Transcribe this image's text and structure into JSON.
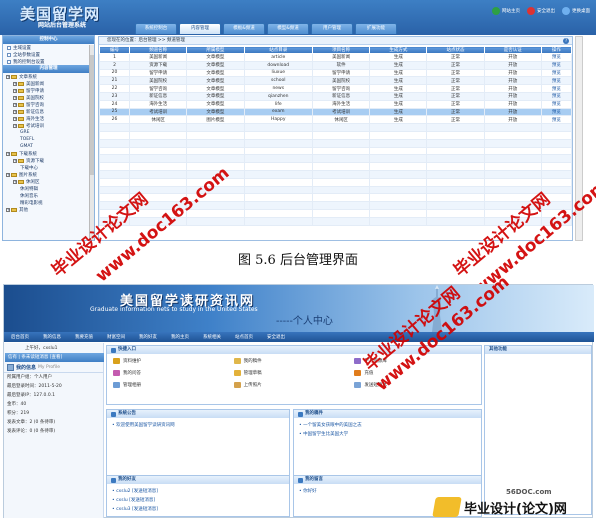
{
  "admin": {
    "logo_big": "美国留学网",
    "logo_small": "网站后台管理系统",
    "tabs": [
      "系统控制台",
      "内容管理",
      "模板&频道",
      "模型&频道",
      "用户管理",
      "扩展功能"
    ],
    "active_tab": 1,
    "actions": [
      "网站主页",
      "安全退出",
      "更换桌面"
    ],
    "sidebar": {
      "header": "控制中心",
      "top_items": [
        "主域设置",
        "全站参数设置",
        "我的控制台设置"
      ],
      "content_header": "内容管理",
      "tree": [
        {
          "label": "文章系统",
          "level": 0,
          "folder": true
        },
        {
          "label": "美国新闻",
          "level": 1,
          "folder": true
        },
        {
          "label": "留学申请",
          "level": 1,
          "folder": true
        },
        {
          "label": "美国院校",
          "level": 1,
          "folder": true
        },
        {
          "label": "留学咨询",
          "level": 1,
          "folder": true
        },
        {
          "label": "新证信息",
          "level": 1,
          "folder": true
        },
        {
          "label": "海外生活",
          "level": 1,
          "folder": true
        },
        {
          "label": "考试培训",
          "level": 1,
          "folder": true
        },
        {
          "label": "GRE",
          "level": 2,
          "folder": false
        },
        {
          "label": "TOEFL",
          "level": 2,
          "folder": false
        },
        {
          "label": "GMAT",
          "level": 2,
          "folder": false
        },
        {
          "label": "下载系统",
          "level": 0,
          "folder": true
        },
        {
          "label": "资源下载",
          "level": 1,
          "folder": true
        },
        {
          "label": "下载中心",
          "level": 2,
          "folder": false
        },
        {
          "label": "图片系统",
          "level": 0,
          "folder": true
        },
        {
          "label": "休闲区",
          "level": 1,
          "folder": true
        },
        {
          "label": "休闲特辑",
          "level": 2,
          "folder": false
        },
        {
          "label": "休闲音乐",
          "level": 2,
          "folder": false
        },
        {
          "label": "精彩电影视",
          "level": 2,
          "folder": false
        },
        {
          "label": "其他",
          "level": 0,
          "folder": true
        }
      ]
    },
    "crumb": "您现在的位置：后台管理 >> 频道管理",
    "table": {
      "headers": [
        "编号",
        "频道名称",
        "所属模型",
        "站点目录",
        "项目名称",
        "生成方式",
        "站点状态",
        "是否认证",
        "操作"
      ],
      "rows": [
        [
          "1",
          "美国新闻",
          "文章模型",
          "article",
          "美国新闻",
          "生成",
          "正常",
          "开放",
          "预览"
        ],
        [
          "2",
          "资源下载",
          "文章模型",
          "download",
          "软件",
          "生成",
          "正常",
          "开放",
          "预览"
        ],
        [
          "20",
          "留学申请",
          "文章模型",
          "liuxue",
          "留学申请",
          "生成",
          "正常",
          "开放",
          "预览"
        ],
        [
          "21",
          "美国院校",
          "文章模型",
          "school",
          "美国院校",
          "生成",
          "正常",
          "开放",
          "预览"
        ],
        [
          "22",
          "留学咨询",
          "文章模型",
          "news",
          "留学咨询",
          "生成",
          "正常",
          "开放",
          "预览"
        ],
        [
          "23",
          "新证信息",
          "文章模型",
          "qianzhen",
          "新证信息",
          "生成",
          "正常",
          "开放",
          "预览"
        ],
        [
          "24",
          "海外生活",
          "文章模型",
          "life",
          "海外生活",
          "生成",
          "正常",
          "开放",
          "预览"
        ],
        [
          "25",
          "考试培训",
          "文章模型",
          "exam",
          "考试培训",
          "生成",
          "正常",
          "开放",
          "预览"
        ],
        [
          "26",
          "休闲区",
          "图片模型",
          "Happy",
          "休闲区",
          "生成",
          "正常",
          "开放",
          "预览"
        ]
      ],
      "selected_row": 7
    }
  },
  "caption": "图 5.6  后台管理界面",
  "personal": {
    "title": "美国留学读研资讯网",
    "subtitle": "Graduate information nets to study in the United States",
    "center": "-----个人中心",
    "nav": [
      "后台首页",
      "我的信息",
      "我要充值",
      "财富空间",
      "我的好友",
      "我的主页",
      "系统相关",
      "站点首页",
      "安全退出"
    ],
    "welcome": "上午好，cxslu1",
    "tab_row": "信有 | 条未读短消息 [查看]",
    "mine_label": "我的信息",
    "mine_en": "My Profile",
    "info_rows": [
      "所属用户组：个人用户",
      "最后登录时间：2011-5-20",
      "最后登录IP：127.0.0.1",
      "金币：40",
      "积分：219",
      "发表文章：2  (0 条待审)",
      "发表评论：0  (0 条待审)"
    ],
    "quick_title": "快捷入口",
    "quick_items": [
      {
        "label": "资料维护",
        "color": "#d9a11c"
      },
      {
        "label": "我的稿件",
        "color": "#e0b74a"
      },
      {
        "label": "学习资源库",
        "color": "#8e6cc9"
      },
      {
        "label": "我的问答",
        "color": "#c45bb0"
      },
      {
        "label": "管理草稿",
        "color": "#e3b13a"
      },
      {
        "label": "充值",
        "color": "#e07c1c"
      },
      {
        "label": "管理相册",
        "color": "#6c9cd5"
      },
      {
        "label": "上传照片",
        "color": "#d4a14b"
      },
      {
        "label": "发送短消息",
        "color": "#7aa3d6"
      }
    ],
    "sys_title": "系统公告",
    "sys_items": [
      "欢迎使用美国留学读研资讯网"
    ],
    "my_works_title": "我的稿件",
    "my_works": [
      "一个留美女孩眼中的美国之志",
      "中国留学生比美国大学"
    ],
    "friends_title": "我的好友",
    "friends": [
      "cxslu2  [发送短消息]",
      "cxslu  [发送短消息]",
      "cxslu3  [发送短消息]"
    ],
    "messages_title": "我的留言",
    "messages": [
      "你好好"
    ],
    "other_title": "其他功能"
  },
  "watermarks": {
    "cn": "毕业设计论文网",
    "url": "www.doc163.com",
    "site56": "56DOC.com",
    "footer_logo": "毕业设计(论文)网"
  }
}
